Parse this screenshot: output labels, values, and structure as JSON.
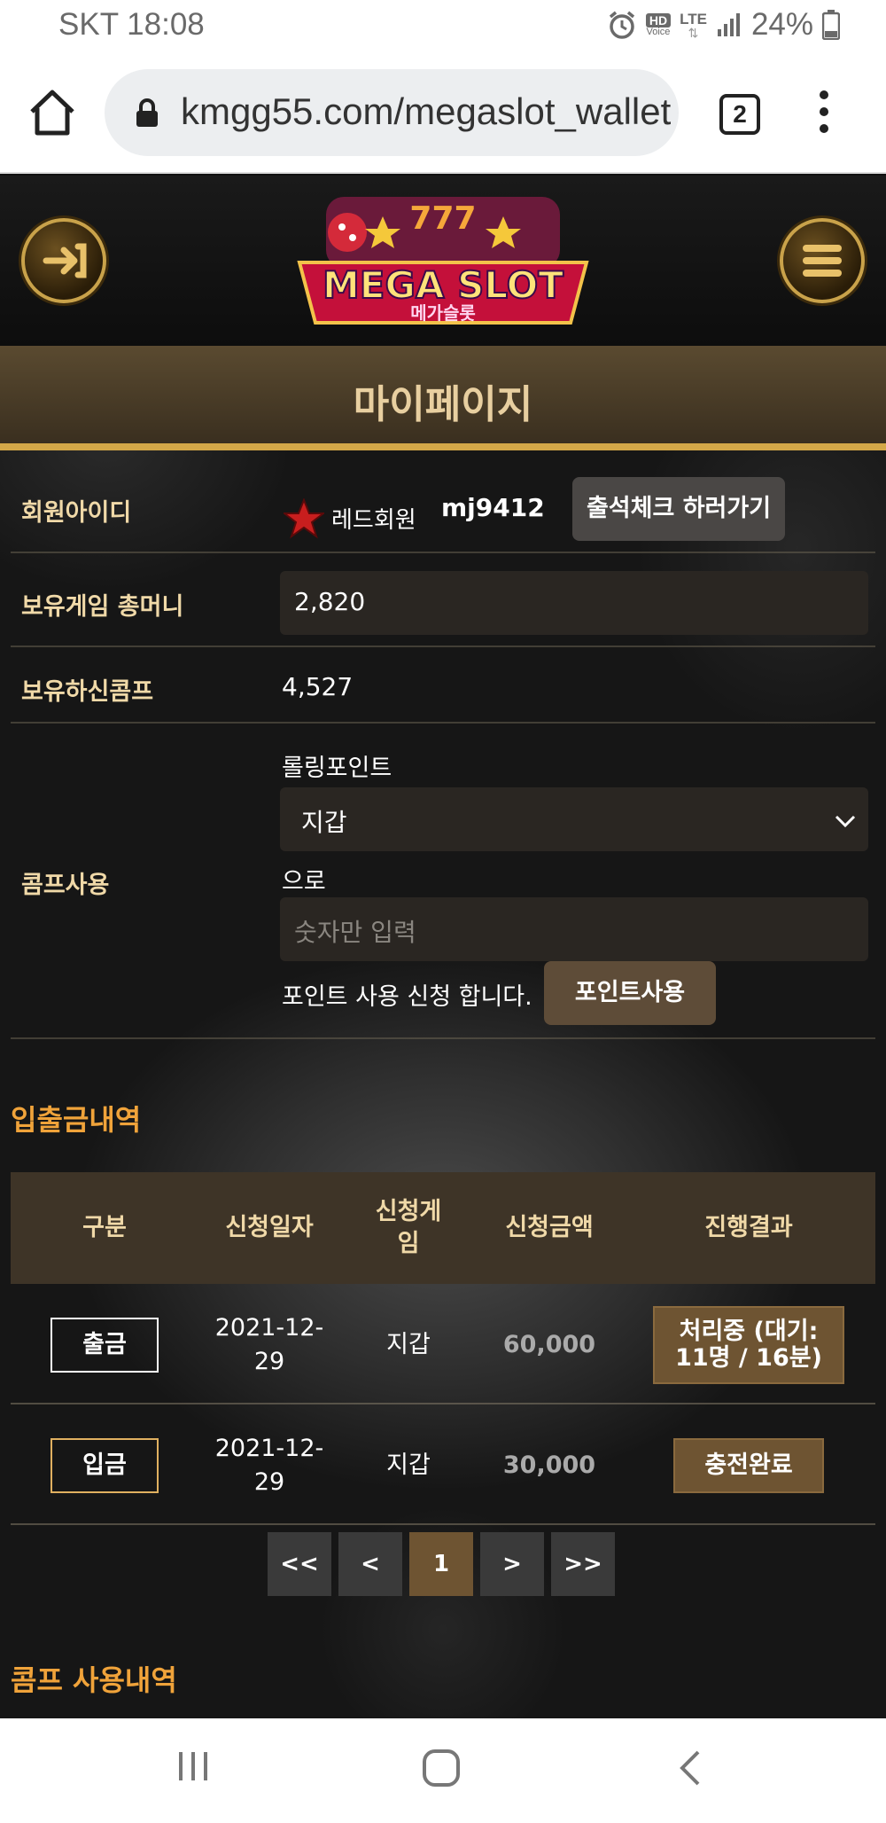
{
  "status_bar": {
    "carrier_time": "SKT 18:08",
    "hd_label": "HD",
    "voice_label": "Voice",
    "lte_label": "LTE",
    "battery": "24%"
  },
  "browser": {
    "url": "kmgg55.com/megaslot_wallet",
    "tab_count": "2"
  },
  "site": {
    "logo_text": "MEGA SLOT",
    "logo_sub": "메가슬롯",
    "page_title": "마이페이지",
    "member": {
      "label": "회원아이디",
      "grade": "레드회원",
      "user_id": "mj9412",
      "attend_button": "출석체크 하러가기"
    },
    "money": {
      "label": "보유게임 총머니",
      "value": "2,820"
    },
    "comp": {
      "label": "보유하신콤프",
      "value": "4,527"
    },
    "comp_use": {
      "label": "콤프사용",
      "rolling_label": "롤링포인트",
      "select_value": "지갑",
      "to_label": "으로",
      "amount_placeholder": "숫자만 입력",
      "apply_text": "포인트 사용 신청 합니다.",
      "apply_button": "포인트사용"
    },
    "history": {
      "title": "입출금내역",
      "headers": [
        "구분",
        "신청일자",
        "신청게임",
        "신청금액",
        "진행결과"
      ],
      "header_game_line1": "신청게",
      "header_game_line2": "임",
      "rows": [
        {
          "type": "출금",
          "date_line1": "2021-12-",
          "date_line2": "29",
          "game": "지갑",
          "amount": "60,000",
          "result_line1": "처리중 (대기:",
          "result_line2": "11명 / 16분)"
        },
        {
          "type": "입금",
          "date_line1": "2021-12-",
          "date_line2": "29",
          "game": "지갑",
          "amount": "30,000",
          "result_line1": "충전완료",
          "result_line2": ""
        }
      ]
    },
    "pagination": {
      "first": "<<",
      "prev": "<",
      "current": "1",
      "next": ">",
      "last": ">>"
    },
    "comp_history_title": "콤프 사용내역"
  },
  "colors": {
    "accent_gold": "#d4a848",
    "section_orange": "#f0a33a",
    "label_cream": "#f0d9a8",
    "badge_brown": "#6e5432"
  }
}
